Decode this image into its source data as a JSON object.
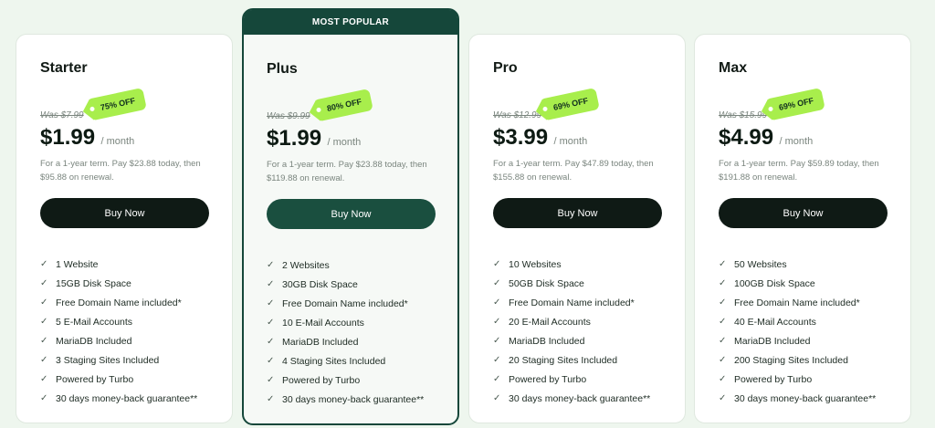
{
  "popular_label": "MOST POPULAR",
  "plans": [
    {
      "name": "Starter",
      "was": "Was $7.99",
      "discount": "75% OFF",
      "price": "$1.99",
      "period": "/ month",
      "term": "For a 1-year term. Pay $23.88 today, then $95.88 on renewal.",
      "button": "Buy Now",
      "features": [
        "1 Website",
        "15GB Disk Space",
        "Free Domain Name included*",
        "5 E-Mail Accounts",
        "MariaDB Included",
        "3 Staging Sites Included",
        "Powered by Turbo",
        "30 days money-back guarantee**"
      ]
    },
    {
      "name": "Plus",
      "was": "Was $9.99",
      "discount": "80% OFF",
      "price": "$1.99",
      "period": "/ month",
      "term": "For a 1-year term. Pay $23.88 today, then $119.88 on renewal.",
      "button": "Buy Now",
      "features": [
        "2 Websites",
        "30GB Disk Space",
        "Free Domain Name included*",
        "10 E-Mail Accounts",
        "MariaDB Included",
        "4 Staging Sites Included",
        "Powered by Turbo",
        "30 days money-back guarantee**"
      ]
    },
    {
      "name": "Pro",
      "was": "Was $12.99",
      "discount": "69% OFF",
      "price": "$3.99",
      "period": "/ month",
      "term": "For a 1-year term. Pay $47.89 today, then $155.88 on renewal.",
      "button": "Buy Now",
      "features": [
        "10 Websites",
        "50GB Disk Space",
        "Free Domain Name included*",
        "20 E-Mail Accounts",
        "MariaDB Included",
        "20 Staging Sites Included",
        "Powered by Turbo",
        "30 days money-back guarantee**"
      ]
    },
    {
      "name": "Max",
      "was": "Was $15.99",
      "discount": "69% OFF",
      "price": "$4.99",
      "period": "/ month",
      "term": "For a 1-year term. Pay $59.89 today, then $191.88 on renewal.",
      "button": "Buy Now",
      "features": [
        "50 Websites",
        "100GB Disk Space",
        "Free Domain Name included*",
        "40 E-Mail Accounts",
        "MariaDB Included",
        "200 Staging Sites Included",
        "Powered by Turbo",
        "30 days money-back guarantee**"
      ]
    }
  ],
  "colors": {
    "accent_dark": "#15473a",
    "button_dark": "#0f1a15",
    "tag_green": "#a8ee4c",
    "background": "#eef6ee"
  },
  "icons": {
    "check": "check-icon"
  }
}
